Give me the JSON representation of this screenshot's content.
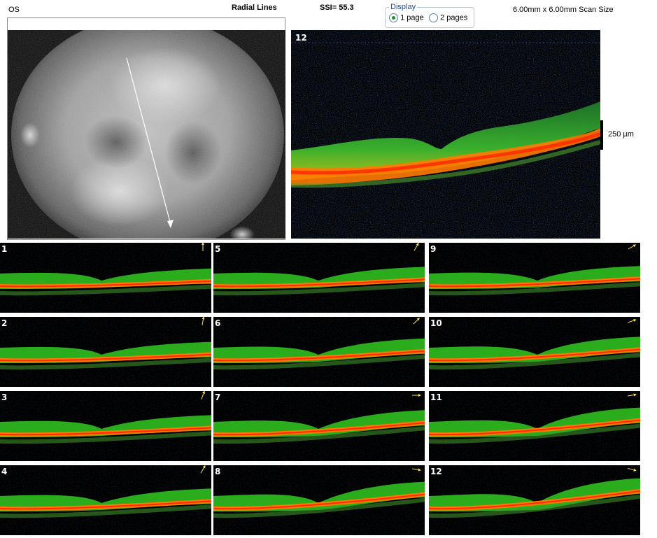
{
  "header": {
    "eye": "OS",
    "scan_type": "Radial Lines",
    "ssi": "SSI= 55.3",
    "scan_size": "6.00mm x 6.00mm Scan Size"
  },
  "display": {
    "legend": "Display",
    "options": [
      {
        "label": "1 page",
        "checked": true
      },
      {
        "label": "2 pages",
        "checked": false
      }
    ]
  },
  "main_scan": {
    "label": "12",
    "scale_label": "250 µm"
  },
  "thumbnails": [
    {
      "label": "1"
    },
    {
      "label": "5"
    },
    {
      "label": "9"
    },
    {
      "label": "2"
    },
    {
      "label": "6"
    },
    {
      "label": "10"
    },
    {
      "label": "3"
    },
    {
      "label": "7"
    },
    {
      "label": "11"
    },
    {
      "label": "4"
    },
    {
      "label": "8"
    },
    {
      "label": "12"
    }
  ],
  "colors": {
    "retina_green": "#2fbf1f",
    "rpe_orange": "#ff7a00",
    "rpe_red": "#ff2a00",
    "arrow": "#ffffff"
  }
}
